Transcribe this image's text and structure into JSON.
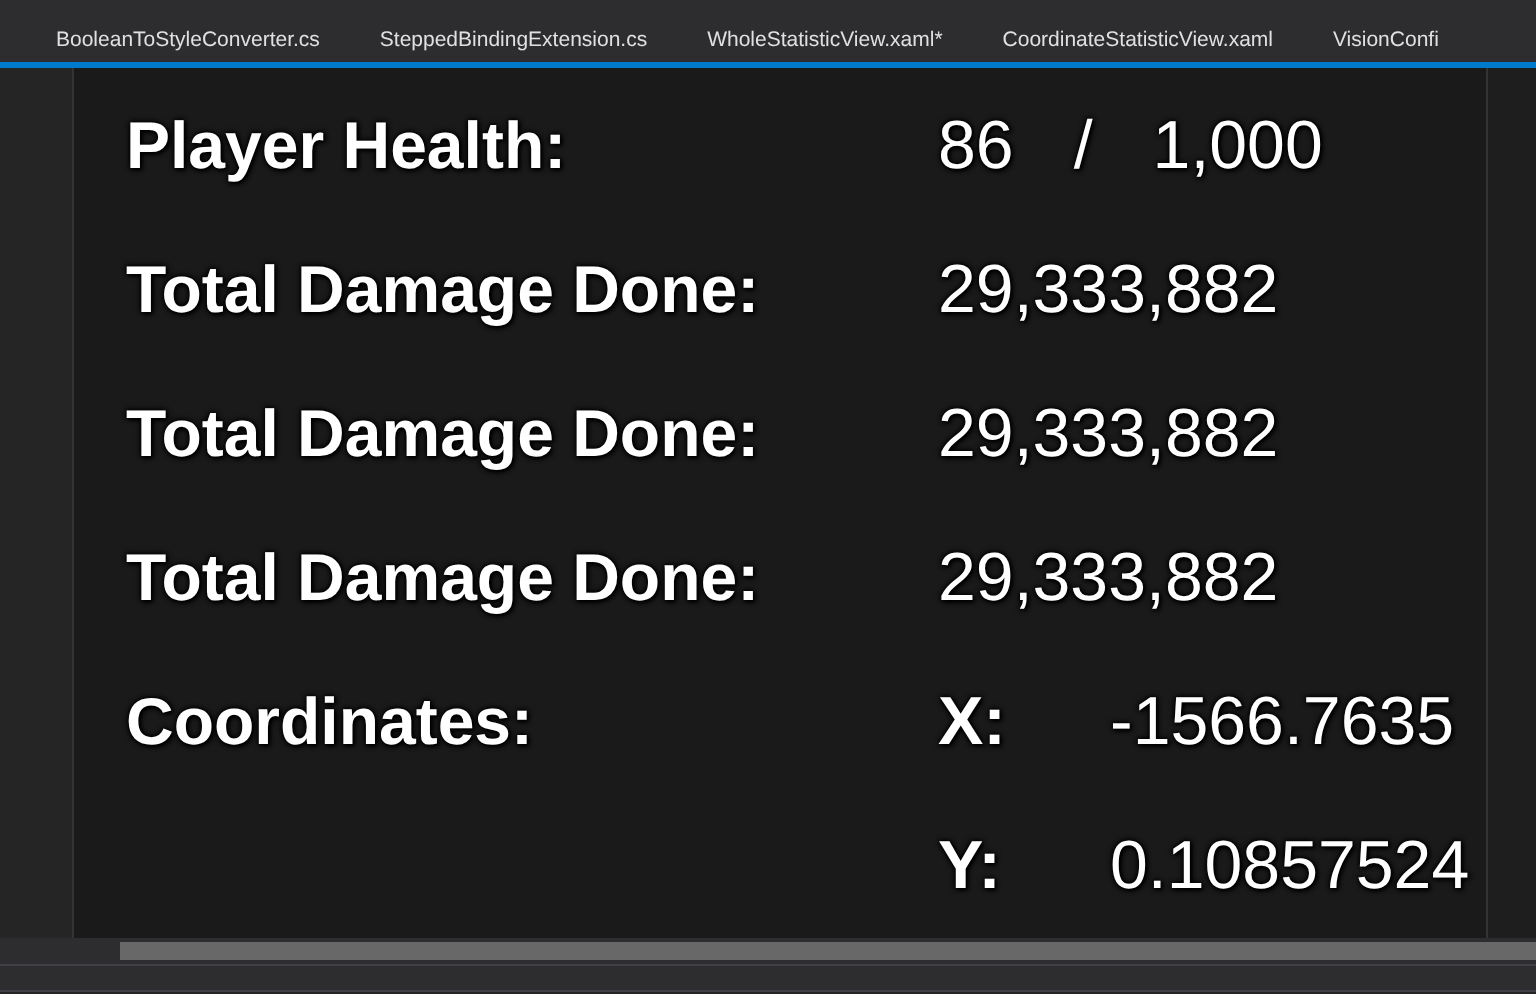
{
  "tabs": [
    {
      "label": "BooleanToStyleConverter.cs"
    },
    {
      "label": "SteppedBindingExtension.cs"
    },
    {
      "label": "WholeStatisticView.xaml*"
    },
    {
      "label": "CoordinateStatisticView.xaml"
    },
    {
      "label": "VisionConfi"
    }
  ],
  "rows": [
    {
      "kind": "ratio",
      "label": "Player Health:",
      "current": "86",
      "separator": "/",
      "max": "1,000"
    },
    {
      "kind": "value",
      "label": "Total Damage Done:",
      "value": "29,333,882"
    },
    {
      "kind": "value",
      "label": "Total Damage Done:",
      "value": "29,333,882"
    },
    {
      "kind": "value",
      "label": "Total Damage Done:",
      "value": "29,333,882"
    },
    {
      "kind": "coordinates",
      "label": "Coordinates:",
      "x_label": "X:",
      "x_value": "-1566.7635",
      "y_label": "Y:",
      "y_value": "0.10857524"
    }
  ]
}
